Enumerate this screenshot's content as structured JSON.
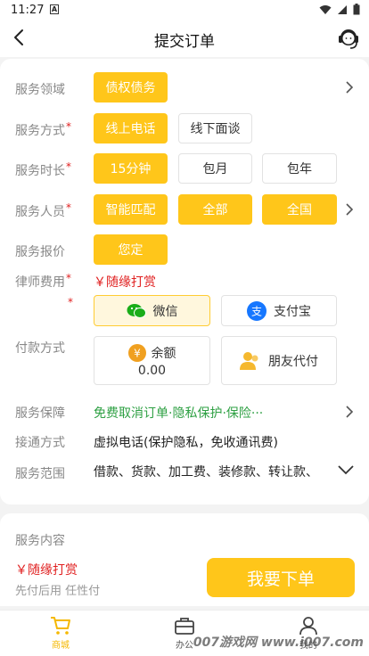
{
  "status_bar": {
    "time": "11:27",
    "notification_letter": "A"
  },
  "nav": {
    "title": "提交订单"
  },
  "form": {
    "domain": {
      "label": "服务领域",
      "selected": "债权债务"
    },
    "method": {
      "label": "服务方式",
      "options": [
        "线上电话",
        "线下面谈"
      ],
      "selected": "线上电话"
    },
    "duration": {
      "label": "服务时长",
      "options": [
        "15分钟",
        "包月",
        "包年"
      ],
      "selected": "15分钟"
    },
    "personnel": {
      "label": "服务人员",
      "options": [
        "智能匹配",
        "全部",
        "全国"
      ]
    },
    "quote": {
      "label": "服务报价",
      "value": "您定"
    },
    "lawyer_fee": {
      "label": "律师费用",
      "value": "￥随缘打赏"
    },
    "payment": {
      "label": "付款方式",
      "wechat": "微信",
      "alipay": "支付宝",
      "balance_label": "余额",
      "balance_value": "0.00",
      "friend_pay": "朋友代付",
      "selected": "微信"
    },
    "guarantee": {
      "label": "服务保障",
      "value": "免费取消订单·隐私保护·保险···"
    },
    "connect": {
      "label": "接通方式",
      "value": "虚拟电话(保护隐私，免收通讯费)"
    },
    "scope": {
      "label": "服务范围",
      "value": "借款、货款、加工费、装修款、转让款、"
    },
    "content": {
      "label": "服务内容"
    }
  },
  "bottom_bar": {
    "price": "￥随缘打赏",
    "note": "先付后用 任性付",
    "order_button": "我要下单"
  },
  "tabbar": {
    "tabs": [
      {
        "label": "商城",
        "active": true
      },
      {
        "label": "办公",
        "active": false
      },
      {
        "label": "我的",
        "active": false
      }
    ]
  },
  "watermark": "007游戏网 www.i007.com",
  "colors": {
    "accent": "#ffc61a",
    "required": "#e02020",
    "guarantee": "#2ea043",
    "wechat": "#1aad19",
    "alipay": "#1677ff",
    "balance": "#f0a020"
  }
}
